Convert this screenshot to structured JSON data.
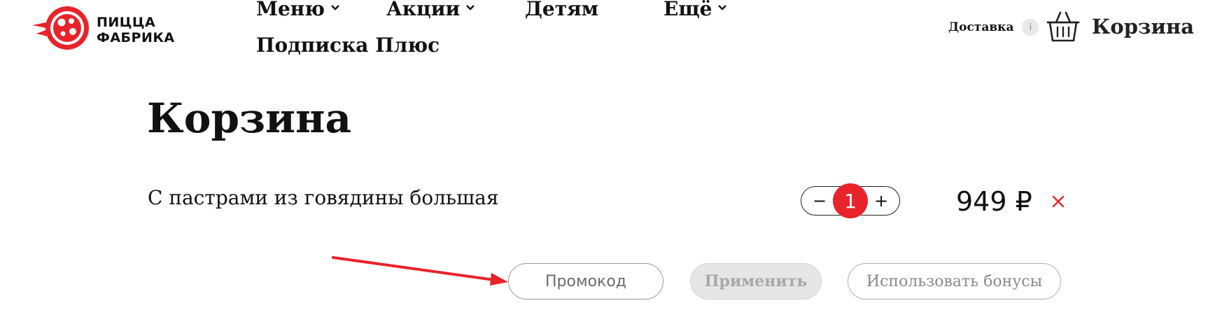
{
  "header": {
    "logo_line1": "ПИЦЦА",
    "logo_line2": "ФАБРИКА",
    "nav": [
      {
        "label": "Меню",
        "has_dropdown": true
      },
      {
        "label": "Акции",
        "has_dropdown": true
      },
      {
        "label": "Детям",
        "has_dropdown": false
      },
      {
        "label": "Ещё",
        "has_dropdown": true
      },
      {
        "label": "Подписка Плюс",
        "has_dropdown": false
      }
    ],
    "delivery_label": "Доставка",
    "info_glyph": "i",
    "cart_label": "Корзина"
  },
  "page": {
    "title": "Корзина"
  },
  "cart": {
    "items": [
      {
        "name": "С пастрами из говядины большая",
        "quantity": "1",
        "price": "949 ₽"
      }
    ],
    "minus_glyph": "−",
    "plus_glyph": "+"
  },
  "actions": {
    "promo_placeholder": "Промокод",
    "apply_label": "Применить",
    "bonus_label": "Использовать бонусы"
  },
  "colors": {
    "brand_red": "#e8232a",
    "text": "#111111",
    "muted": "#8a8a8a"
  },
  "icons": {
    "logo": "pizza-logo-icon",
    "dropdown": "chevron-down-icon",
    "info": "info-icon",
    "cart": "basket-icon",
    "remove": "close-icon",
    "annotation": "arrow-icon"
  }
}
